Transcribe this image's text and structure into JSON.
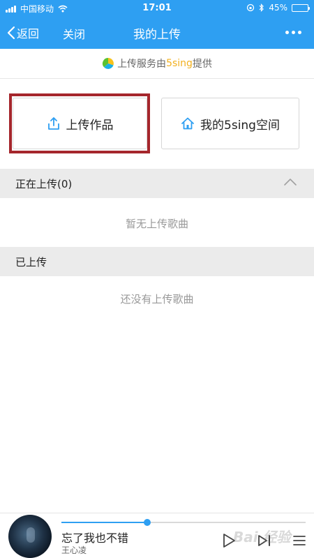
{
  "status_bar": {
    "carrier": "中国移动",
    "time": "17:01",
    "battery": "45%",
    "battery_level": 0.45
  },
  "nav": {
    "back_label": "返回",
    "close_label": "关闭",
    "title": "我的上传",
    "more_icon": "more-icon"
  },
  "provider": {
    "text_before": "上传服务由",
    "brand": "5sing",
    "text_after": "提供"
  },
  "actions": {
    "upload_label": "上传作品",
    "space_label": "我的5sing空间"
  },
  "sections": {
    "uploading_header": "正在上传(0)",
    "uploading_empty": "暂无上传歌曲",
    "uploaded_header": "已上传",
    "uploaded_empty": "还没有上传歌曲"
  },
  "player": {
    "song_title": "忘了我也不错",
    "artist": "王心凌",
    "progress": 0.35
  },
  "watermark": "Bai 经验",
  "colors": {
    "primary": "#2e9ff2",
    "accent": "#f2b01e",
    "highlight": "#a5262c"
  }
}
